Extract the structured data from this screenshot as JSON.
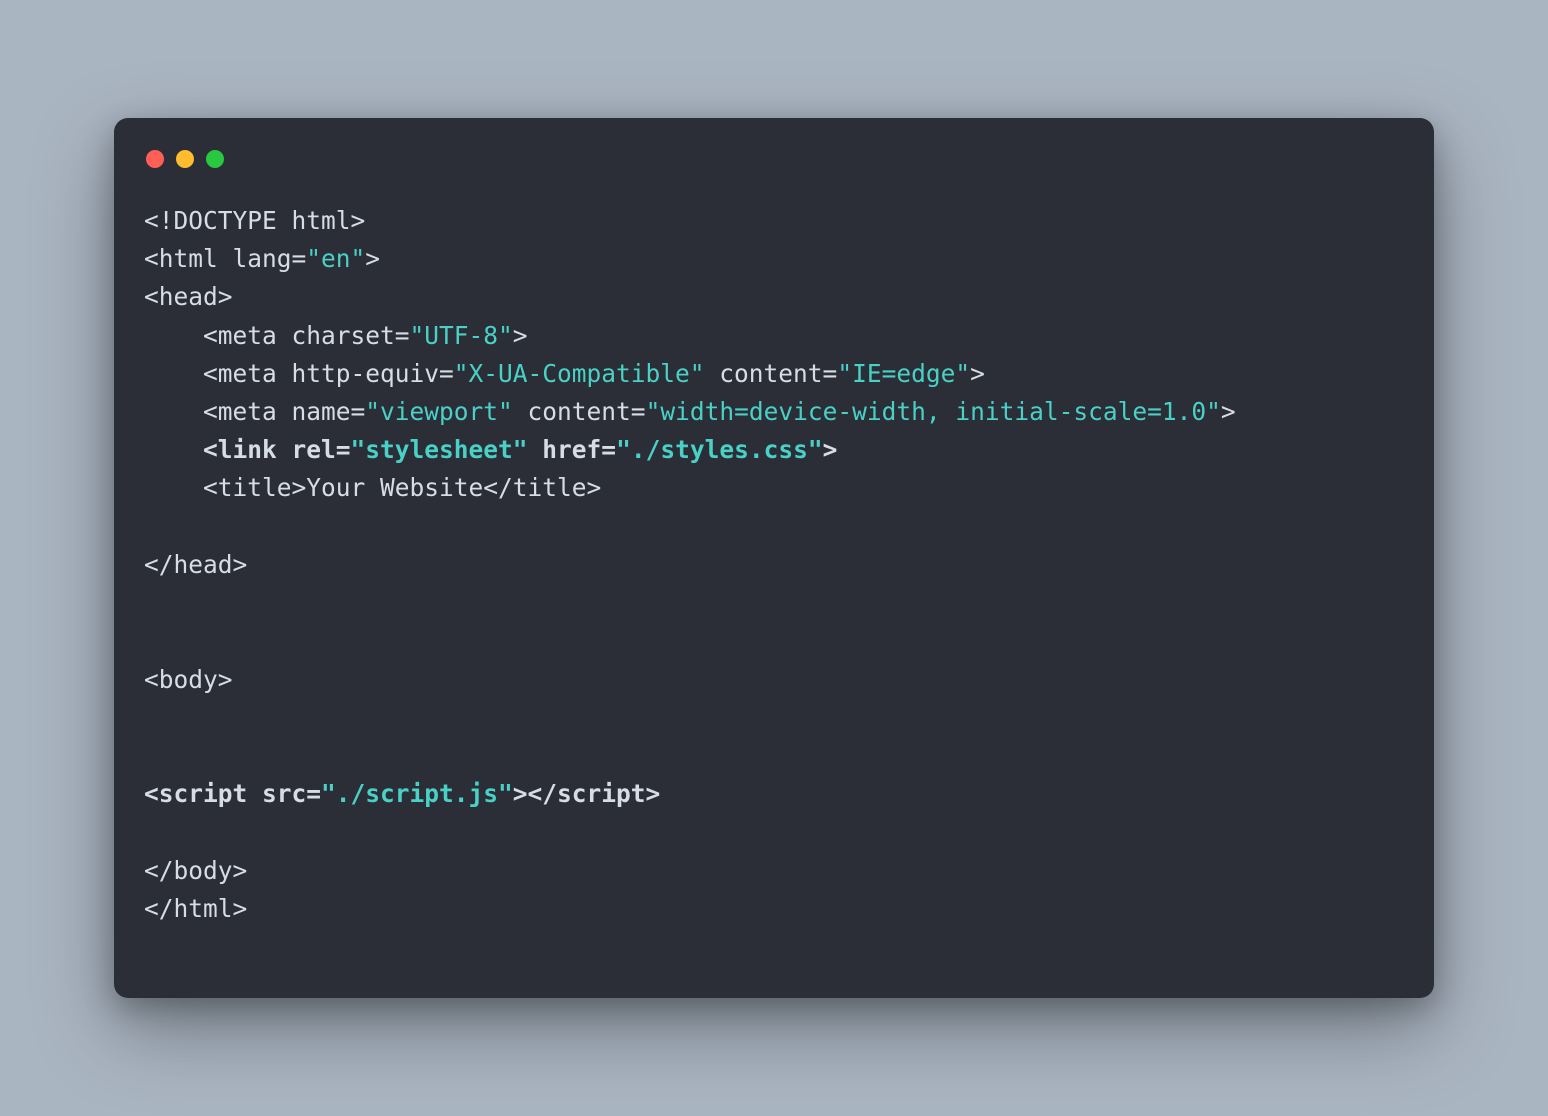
{
  "traffic_lights": {
    "red": "#ff5f57",
    "yellow": "#febc2e",
    "green": "#28c840"
  },
  "code": {
    "l1": {
      "a": "<!DOCTYPE html>"
    },
    "l2": {
      "a": "<html lang=",
      "b": "\"en\"",
      "c": ">"
    },
    "l3": {
      "a": "<head>"
    },
    "l4": {
      "indent": "    ",
      "a": "<meta charset=",
      "b": "\"UTF-8\"",
      "c": ">"
    },
    "l5": {
      "indent": "    ",
      "a": "<meta http-equiv=",
      "b": "\"X-UA-Compatible\"",
      "c": " content=",
      "d": "\"IE=edge\"",
      "e": ">"
    },
    "l6": {
      "indent": "    ",
      "a": "<meta name=",
      "b": "\"viewport\"",
      "c": " content=",
      "d": "\"width=device-width, initial-scale=1.0\"",
      "e": ">"
    },
    "l7": {
      "indent": "    ",
      "a": "<link rel=",
      "b": "\"stylesheet\"",
      "c": " href=",
      "d": "\"./styles.css\"",
      "e": ">"
    },
    "l8": {
      "indent": "    ",
      "a": "<title>Your Website</title>"
    },
    "blank": " ",
    "l9": {
      "a": "</head>"
    },
    "l10": {
      "a": "<body>"
    },
    "l11": {
      "a": "<script src=",
      "b": "\"./script.js\"",
      "c": "></script",
      "d": ">"
    },
    "l12": {
      "a": "</body>"
    },
    "l13": {
      "a": "</html>"
    }
  }
}
